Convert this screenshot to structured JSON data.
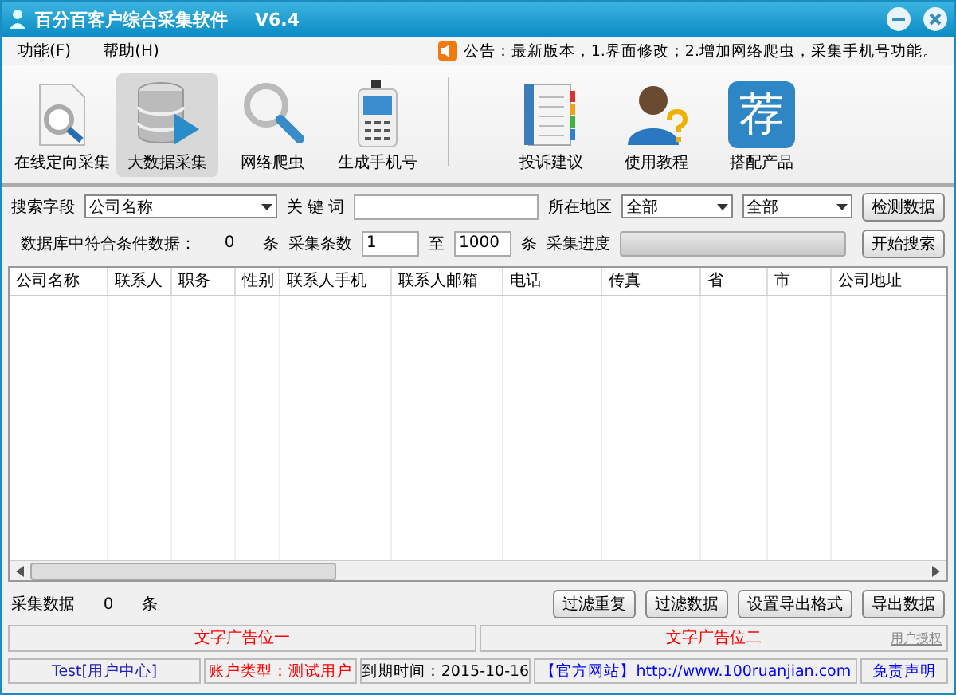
{
  "window": {
    "title": "百分百客户综合采集软件",
    "version": "V6.4"
  },
  "menu": [
    "功能(F)",
    "帮助(H)"
  ],
  "notice": "公告：最新版本，1.界面修改；2.增加网络爬虫，采集手机号功能。",
  "toolbar": [
    {
      "label": "在线定向采集",
      "kind": "document",
      "selected": false
    },
    {
      "label": "大数据采集",
      "kind": "database",
      "selected": true
    },
    {
      "label": "网络爬虫",
      "kind": "magnifier",
      "selected": false
    },
    {
      "label": "生成手机号",
      "kind": "phone",
      "selected": false
    },
    {
      "label": "投诉建议",
      "kind": "notebook",
      "selected": false
    },
    {
      "label": "使用教程",
      "kind": "person",
      "selected": false
    },
    {
      "label": "搭配产品",
      "kind": "badge",
      "selected": false,
      "glyph": "荐"
    }
  ],
  "search": {
    "field_label": "搜索字段",
    "field_value": "公司名称",
    "keyword_label": "关 键 词",
    "region_label": "所在地区",
    "province": "全部",
    "city": "全部",
    "check_button": "检测数据"
  },
  "collect": {
    "count_label": "数据库中符合条件数据：",
    "count": "0",
    "unit": "条",
    "range_label": "采集条数",
    "from": "1",
    "to_label": "至",
    "to": "1000",
    "unit2": "条",
    "progress_label": "采集进度",
    "level": 0,
    "start_button": "开始搜索"
  },
  "table": {
    "columns": [
      "公司名称",
      "联系人",
      "职务",
      "性别",
      "联系人手机",
      "联系人邮箱",
      "电话",
      "传真",
      "省",
      "市",
      "公司地址"
    ]
  },
  "footer": {
    "collected_label": "采集数据",
    "collected": "0",
    "unit": "条",
    "buttons": [
      "过滤重复",
      "过滤数据",
      "设置导出格式",
      "导出数据"
    ]
  },
  "ads": [
    "文字广告位一",
    "文字广告位二"
  ],
  "ad_note": "用户授权",
  "status_bar": [
    {
      "text": "Test[用户中心]",
      "color": "#2020c0"
    },
    {
      "text": "账户类型：测试用户",
      "color": "#ff0000"
    },
    {
      "text": "到期时间：2015-10-16",
      "color": "#000000"
    },
    {
      "text": "【官方网站】http://www.100ruanjian.com",
      "color": "#0000ff"
    },
    {
      "text": "免责声明",
      "color": "#0000ff"
    }
  ]
}
